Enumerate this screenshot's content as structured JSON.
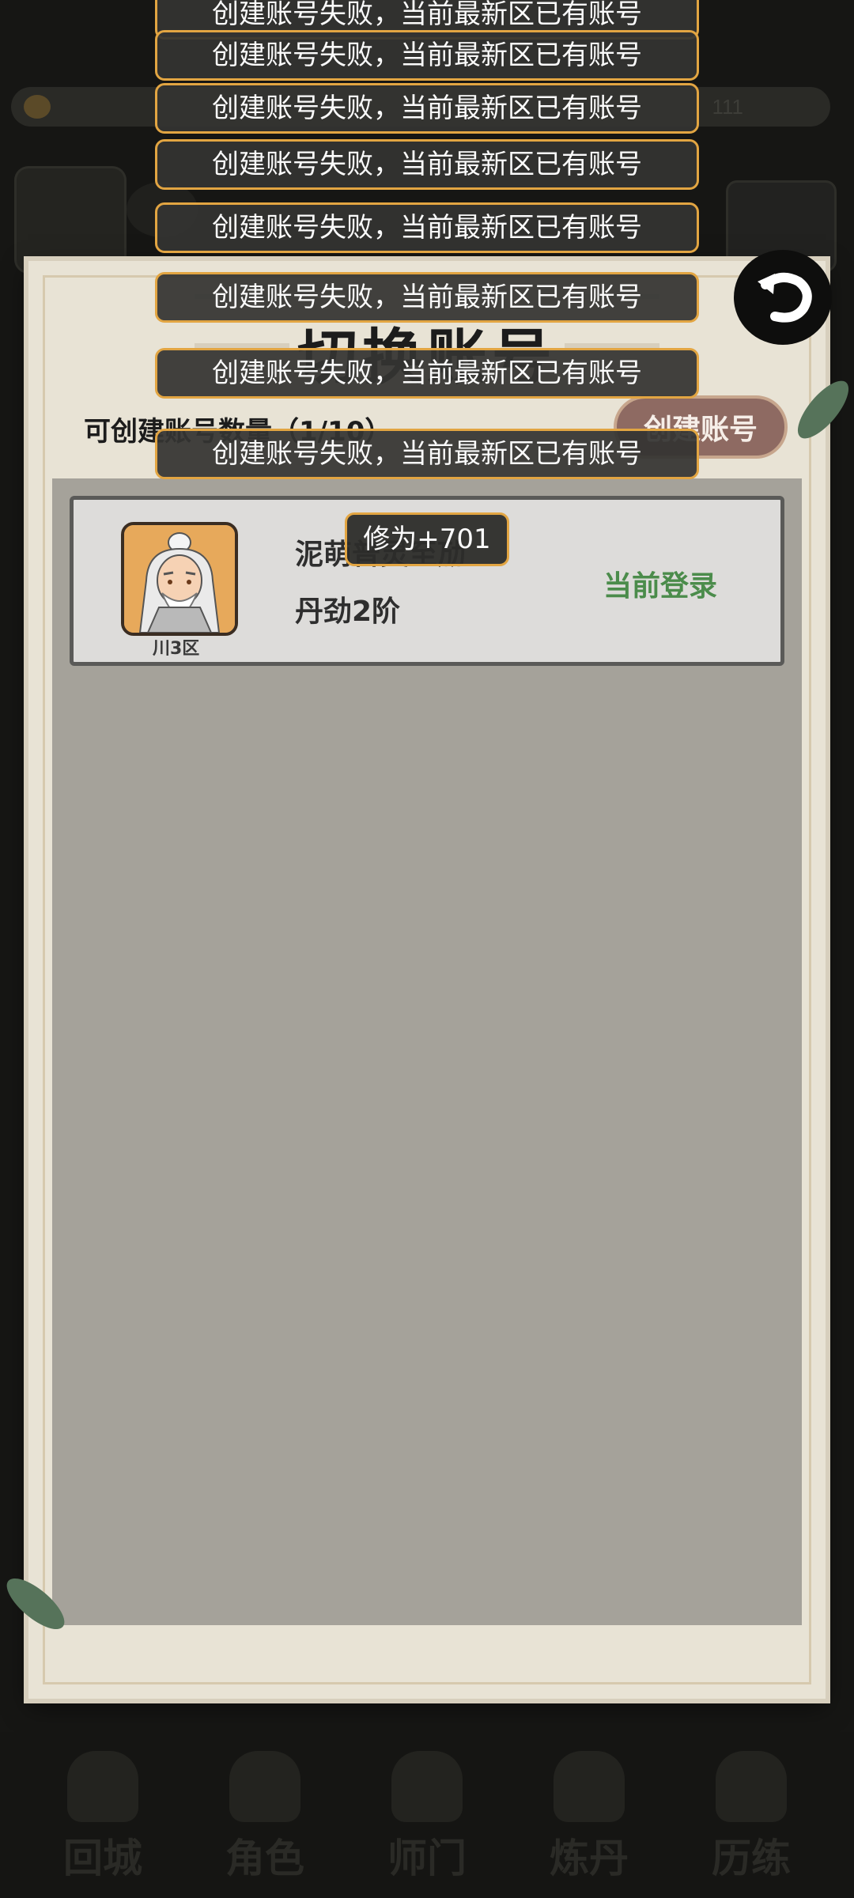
{
  "background": {
    "top_number": "111"
  },
  "toasts": [
    "创建账号失败，当前最新区已有账号",
    "创建账号失败，当前最新区已有账号",
    "创建账号失败，当前最新区已有账号",
    "创建账号失败，当前最新区已有账号",
    "创建账号失败，当前最新区已有账号",
    "创建账号失败，当前最新区已有账号",
    "创建账号失败，当前最新区已有账号",
    "创建账号失败，当前最新区已有账号"
  ],
  "cultivation_toast": "修为+701",
  "panel": {
    "title": "切换账号",
    "create_count_label": "可创建账号数量（1/10）",
    "create_button": "创建账号",
    "back_icon": "back-arrow-icon"
  },
  "account": {
    "name": "泥萌普灵至劢",
    "rank": "丹劲2阶",
    "server": "川3区",
    "status": "当前登录"
  },
  "nav": {
    "items": [
      "回城",
      "角色",
      "师门",
      "炼丹",
      "历练"
    ]
  },
  "colors": {
    "panel_bg": "#e8e3d5",
    "list_bg": "#a5a29a",
    "toast_border": "#e2a542",
    "current_login": "#4b8c4b",
    "create_button": "#8e6a62"
  }
}
